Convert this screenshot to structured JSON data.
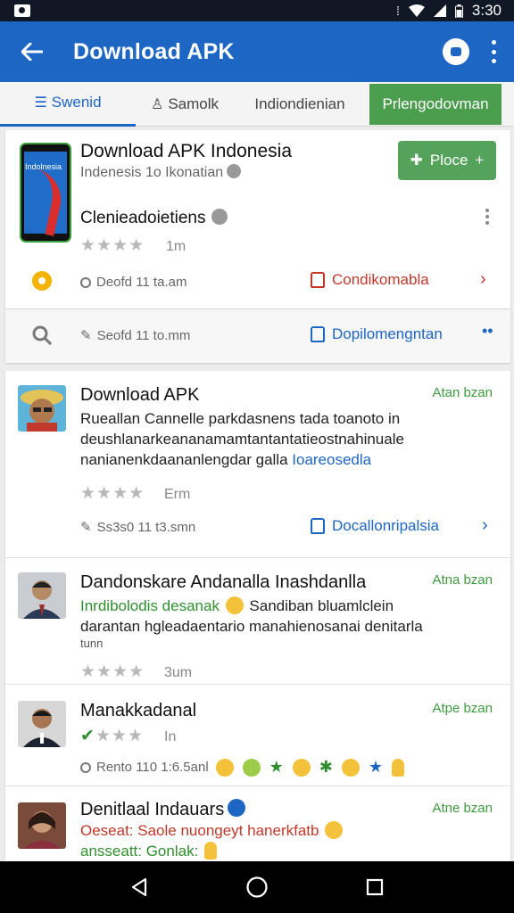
{
  "status_bar": {
    "time": "3:30",
    "icons": [
      "notification-icon",
      "vibrate-icon",
      "wifi-icon",
      "signal-icon",
      "battery-icon"
    ]
  },
  "app_bar": {
    "title": "Download APK",
    "icons": [
      "back-arrow-icon",
      "chat-icon",
      "more-vert-icon"
    ],
    "color": "#1d66c4"
  },
  "tabs": [
    {
      "label": "Swenid",
      "icon": "list-icon",
      "selected": true
    },
    {
      "label": "Samolk",
      "icon": "person-icon",
      "selected": false
    },
    {
      "label": "Indiondienian",
      "selected": false
    },
    {
      "label": "Prlengodovman",
      "selected": false,
      "highlight_color": "#4a9e4e"
    }
  ],
  "featured": {
    "thumb_text": "Indolnesia",
    "title": "Download APK Indonesia",
    "subtitle": "Indenesis 1o Ikonatian",
    "place_button": "Ploce",
    "name": "Clenieadoietiens",
    "rating_count": "1m",
    "meta": "Deofd 11 ta.am",
    "action_red": "Condikomabla",
    "meta2": "Seofd 11 to.mm",
    "action_blue": "Dopilomengntan"
  },
  "posts": [
    {
      "author": "Download APK",
      "time": "Atan bzan",
      "body_lines": [
        "Rueallan Cannelle parkdasnens tada toanoto in",
        "deushlanarkeananamamtantantatieostnahinuale",
        "nanianenkdaananlengdar galla "
      ],
      "body_link": "Ioareosedla",
      "rating_count": "Erm",
      "meta": "Ss3s0 11 t3.smn",
      "action": "Docallonripalsia"
    },
    {
      "author": "Dandonskare Andanalla Inashdanlla",
      "time": "Atna bzan",
      "body_green": "Inrdibolodis desanak",
      "body_green2": "Sandiban bluamlclein",
      "body_line2": "darantan hgleadaentario manahienosanai denitarla",
      "body_line3": "tunn",
      "rating_count": "3um"
    },
    {
      "author": "Manakkadanal",
      "time": "Atpe bzan",
      "rating_count": "In",
      "meta": "Rento 110 1:6.5anl"
    },
    {
      "author": "Denitlaal Indauars",
      "time": "Atne bzan",
      "body_red": "Oeseat: Saole nuongeyt hanerkfatb",
      "body_line2": "ansseatt: Gonlak:"
    }
  ],
  "nav_bar": {
    "icons": [
      "back-triangle-icon",
      "home-circle-icon",
      "recents-square-icon"
    ]
  }
}
